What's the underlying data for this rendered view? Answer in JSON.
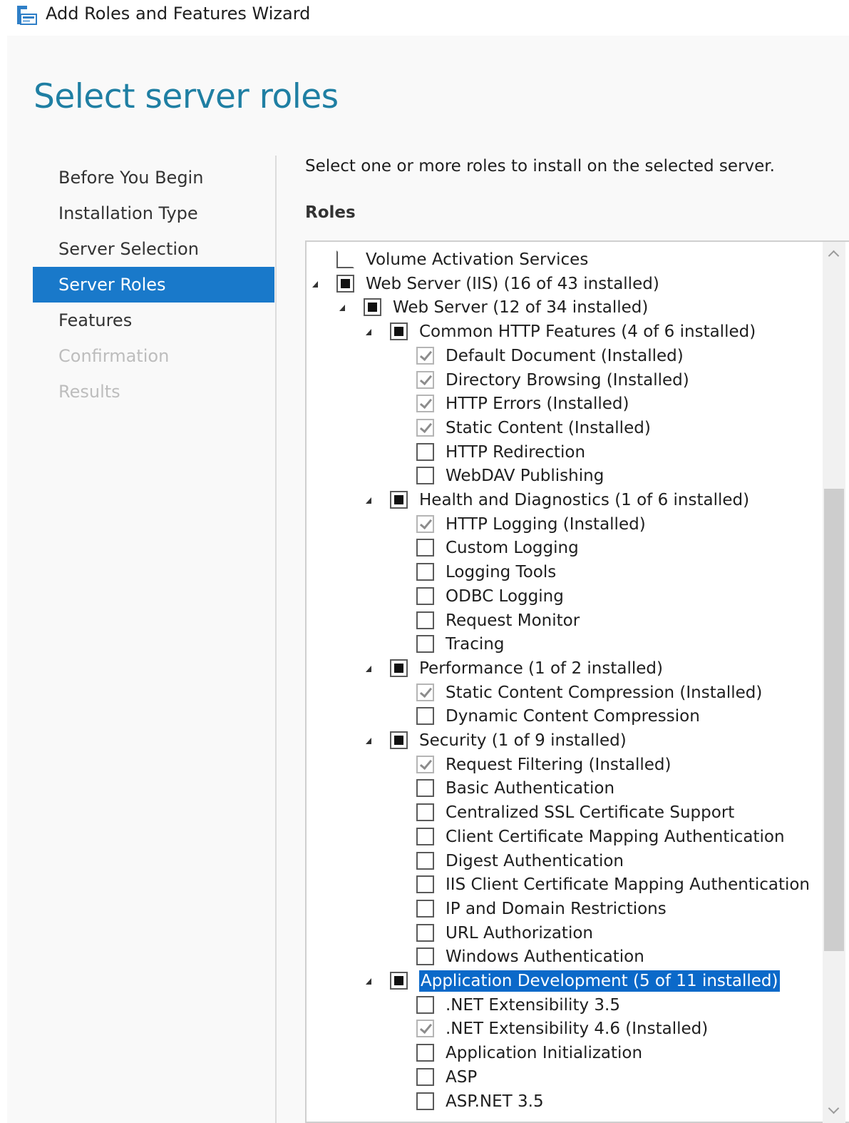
{
  "window": {
    "title": "Add Roles and Features Wizard"
  },
  "page": {
    "title": "Select server roles"
  },
  "nav": {
    "items": [
      {
        "label": "Before You Begin",
        "state": "normal"
      },
      {
        "label": "Installation Type",
        "state": "normal"
      },
      {
        "label": "Server Selection",
        "state": "normal"
      },
      {
        "label": "Server Roles",
        "state": "active"
      },
      {
        "label": "Features",
        "state": "normal"
      },
      {
        "label": "Confirmation",
        "state": "disabled"
      },
      {
        "label": "Results",
        "state": "disabled"
      }
    ]
  },
  "main": {
    "instruction": "Select one or more roles to install on the selected server.",
    "roles_heading": "Roles"
  },
  "colors": {
    "accent": "#1979ca",
    "title": "#1f7fa3",
    "selection": "#0b69c9"
  },
  "tree": [
    {
      "label": "Volume Activation Services",
      "level": 0,
      "expanded": null,
      "check": "unchecked"
    },
    {
      "label": "Web Server (IIS) (16 of 43 installed)",
      "level": 0,
      "expanded": true,
      "check": "partial"
    },
    {
      "label": "Web Server (12 of 34 installed)",
      "level": 1,
      "expanded": true,
      "check": "partial"
    },
    {
      "label": "Common HTTP Features (4 of 6 installed)",
      "level": 2,
      "expanded": true,
      "check": "partial"
    },
    {
      "label": "Default Document (Installed)",
      "level": 3,
      "expanded": null,
      "check": "checked"
    },
    {
      "label": "Directory Browsing (Installed)",
      "level": 3,
      "expanded": null,
      "check": "checked"
    },
    {
      "label": "HTTP Errors (Installed)",
      "level": 3,
      "expanded": null,
      "check": "checked"
    },
    {
      "label": "Static Content (Installed)",
      "level": 3,
      "expanded": null,
      "check": "checked"
    },
    {
      "label": "HTTP Redirection",
      "level": 3,
      "expanded": null,
      "check": "unchecked"
    },
    {
      "label": "WebDAV Publishing",
      "level": 3,
      "expanded": null,
      "check": "unchecked"
    },
    {
      "label": "Health and Diagnostics (1 of 6 installed)",
      "level": 2,
      "expanded": true,
      "check": "partial"
    },
    {
      "label": "HTTP Logging (Installed)",
      "level": 3,
      "expanded": null,
      "check": "checked"
    },
    {
      "label": "Custom Logging",
      "level": 3,
      "expanded": null,
      "check": "unchecked"
    },
    {
      "label": "Logging Tools",
      "level": 3,
      "expanded": null,
      "check": "unchecked"
    },
    {
      "label": "ODBC Logging",
      "level": 3,
      "expanded": null,
      "check": "unchecked"
    },
    {
      "label": "Request Monitor",
      "level": 3,
      "expanded": null,
      "check": "unchecked"
    },
    {
      "label": "Tracing",
      "level": 3,
      "expanded": null,
      "check": "unchecked"
    },
    {
      "label": "Performance (1 of 2 installed)",
      "level": 2,
      "expanded": true,
      "check": "partial"
    },
    {
      "label": "Static Content Compression (Installed)",
      "level": 3,
      "expanded": null,
      "check": "checked"
    },
    {
      "label": "Dynamic Content Compression",
      "level": 3,
      "expanded": null,
      "check": "unchecked"
    },
    {
      "label": "Security (1 of 9 installed)",
      "level": 2,
      "expanded": true,
      "check": "partial"
    },
    {
      "label": "Request Filtering (Installed)",
      "level": 3,
      "expanded": null,
      "check": "checked"
    },
    {
      "label": "Basic Authentication",
      "level": 3,
      "expanded": null,
      "check": "unchecked"
    },
    {
      "label": "Centralized SSL Certificate Support",
      "level": 3,
      "expanded": null,
      "check": "unchecked"
    },
    {
      "label": "Client Certificate Mapping Authentication",
      "level": 3,
      "expanded": null,
      "check": "unchecked"
    },
    {
      "label": "Digest Authentication",
      "level": 3,
      "expanded": null,
      "check": "unchecked"
    },
    {
      "label": "IIS Client Certificate Mapping Authentication",
      "level": 3,
      "expanded": null,
      "check": "unchecked"
    },
    {
      "label": "IP and Domain Restrictions",
      "level": 3,
      "expanded": null,
      "check": "unchecked"
    },
    {
      "label": "URL Authorization",
      "level": 3,
      "expanded": null,
      "check": "unchecked"
    },
    {
      "label": "Windows Authentication",
      "level": 3,
      "expanded": null,
      "check": "unchecked"
    },
    {
      "label": "Application Development (5 of 11 installed)",
      "level": 2,
      "expanded": true,
      "check": "partial",
      "selected": true
    },
    {
      "label": ".NET Extensibility 3.5",
      "level": 3,
      "expanded": null,
      "check": "unchecked"
    },
    {
      "label": ".NET Extensibility 4.6 (Installed)",
      "level": 3,
      "expanded": null,
      "check": "checked"
    },
    {
      "label": "Application Initialization",
      "level": 3,
      "expanded": null,
      "check": "unchecked"
    },
    {
      "label": "ASP",
      "level": 3,
      "expanded": null,
      "check": "unchecked"
    },
    {
      "label": "ASP.NET 3.5",
      "level": 3,
      "expanded": null,
      "check": "unchecked"
    }
  ]
}
